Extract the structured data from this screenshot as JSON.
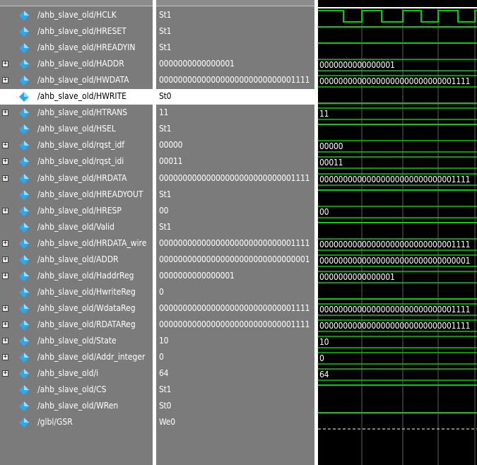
{
  "header": {
    "names_caption": ""
  },
  "colors": {
    "wave_green": "#00d000",
    "icon_blue": "#2aa9f0",
    "panel_gray": "#7b7b7b"
  },
  "signals": [
    {
      "name": "/ahb_slave_old/HCLK",
      "value": "St1",
      "kind": "clock",
      "expandable": false,
      "selected": false
    },
    {
      "name": "/ahb_slave_old/HRESET",
      "value": "St1",
      "kind": "high",
      "expandable": false,
      "selected": false
    },
    {
      "name": "/ahb_slave_old/HREADYIN",
      "value": "St1",
      "kind": "high",
      "expandable": false,
      "selected": false
    },
    {
      "name": "/ahb_slave_old/HADDR",
      "value": "0000000000000001",
      "kind": "bus",
      "wave_text": "0000000000000001",
      "expandable": true,
      "selected": false
    },
    {
      "name": "/ahb_slave_old/HWDATA",
      "value": "00000000000000000000000000001111",
      "kind": "bus",
      "wave_text": "00000000000000000000000000001111",
      "expandable": true,
      "selected": false
    },
    {
      "name": "/ahb_slave_old/HWRITE",
      "value": "St0",
      "kind": "low",
      "expandable": false,
      "selected": true
    },
    {
      "name": "/ahb_slave_old/HTRANS",
      "value": "11",
      "kind": "bus",
      "wave_text": "11",
      "expandable": true,
      "selected": false
    },
    {
      "name": "/ahb_slave_old/HSEL",
      "value": "St1",
      "kind": "high",
      "expandable": false,
      "selected": false
    },
    {
      "name": "/ahb_slave_old/rqst_idf",
      "value": "00000",
      "kind": "bus",
      "wave_text": "00000",
      "expandable": true,
      "selected": false
    },
    {
      "name": "/ahb_slave_old/rqst_idi",
      "value": "00011",
      "kind": "bus",
      "wave_text": "00011",
      "expandable": true,
      "selected": false
    },
    {
      "name": "/ahb_slave_old/HRDATA",
      "value": "00000000000000000000000000001111",
      "kind": "bus",
      "wave_text": "00000000000000000000000000001111",
      "expandable": true,
      "selected": false
    },
    {
      "name": "/ahb_slave_old/HREADYOUT",
      "value": "St1",
      "kind": "high",
      "expandable": false,
      "selected": false
    },
    {
      "name": "/ahb_slave_old/HRESP",
      "value": "00",
      "kind": "bus",
      "wave_text": "00",
      "expandable": true,
      "selected": false
    },
    {
      "name": "/ahb_slave_old/Valid",
      "value": "St1",
      "kind": "high",
      "expandable": false,
      "selected": false
    },
    {
      "name": "/ahb_slave_old/HRDATA_wire",
      "value": "00000000000000000000000000001111",
      "kind": "bus",
      "wave_text": "00000000000000000000000000001111",
      "expandable": true,
      "selected": false
    },
    {
      "name": "/ahb_slave_old/ADDR",
      "value": "00000000000000000000000000000001",
      "kind": "bus",
      "wave_text": "00000000000000000000000000000001",
      "expandable": true,
      "selected": false
    },
    {
      "name": "/ahb_slave_old/HaddrReg",
      "value": "0000000000000001",
      "kind": "bus",
      "wave_text": "0000000000000001",
      "expandable": true,
      "selected": false
    },
    {
      "name": "/ahb_slave_old/HwriteReg",
      "value": "0",
      "kind": "low",
      "expandable": false,
      "selected": false
    },
    {
      "name": "/ahb_slave_old/WdataReg",
      "value": "00000000000000000000000000001111",
      "kind": "bus",
      "wave_text": "00000000000000000000000000001111",
      "expandable": true,
      "selected": false
    },
    {
      "name": "/ahb_slave_old/RDATAReg",
      "value": "00000000000000000000000000001111",
      "kind": "bus",
      "wave_text": "00000000000000000000000000001111",
      "expandable": true,
      "selected": false
    },
    {
      "name": "/ahb_slave_old/State",
      "value": "10",
      "kind": "bus",
      "wave_text": "10",
      "expandable": true,
      "selected": false
    },
    {
      "name": "/ahb_slave_old/Addr_integer",
      "value": "0",
      "kind": "bus",
      "wave_text": "0",
      "expandable": true,
      "selected": false
    },
    {
      "name": "/ahb_slave_old/i",
      "value": "64",
      "kind": "bus",
      "wave_text": "64",
      "expandable": true,
      "selected": false
    },
    {
      "name": "/ahb_slave_old/CS",
      "value": "St1",
      "kind": "high",
      "expandable": false,
      "selected": false
    },
    {
      "name": "/ahb_slave_old/WRen",
      "value": "St0",
      "kind": "low",
      "expandable": false,
      "selected": false
    },
    {
      "name": "/glbl/GSR",
      "value": "We0",
      "kind": "weak-low",
      "expandable": false,
      "selected": false
    }
  ]
}
